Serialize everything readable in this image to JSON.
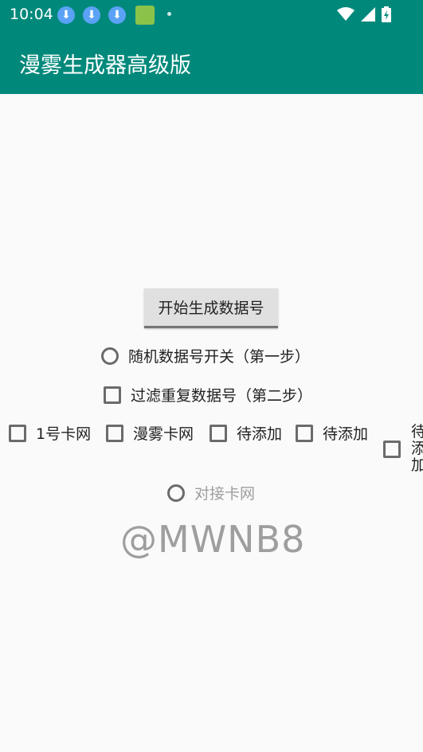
{
  "status_bar": {
    "time": "10:04",
    "icons": [
      "download-icon",
      "download-icon",
      "download-icon",
      "app-icon",
      "dot",
      "wifi-icon",
      "signal-icon",
      "battery-icon"
    ]
  },
  "app_bar": {
    "title": "漫雾生成器高级版"
  },
  "main": {
    "start_button": "开始生成数据号",
    "random_toggle": "随机数据号开关（第一步）",
    "filter_dup": "过滤重复数据号（第二步）",
    "site_options": [
      "1号卡网",
      "漫雾卡网",
      "待添加",
      "待添加",
      "待添加"
    ],
    "connect_site": "对接卡网",
    "handle": "@MWNB8"
  },
  "colors": {
    "accent": "#00897b",
    "muted_text": "#9e9e9e"
  }
}
